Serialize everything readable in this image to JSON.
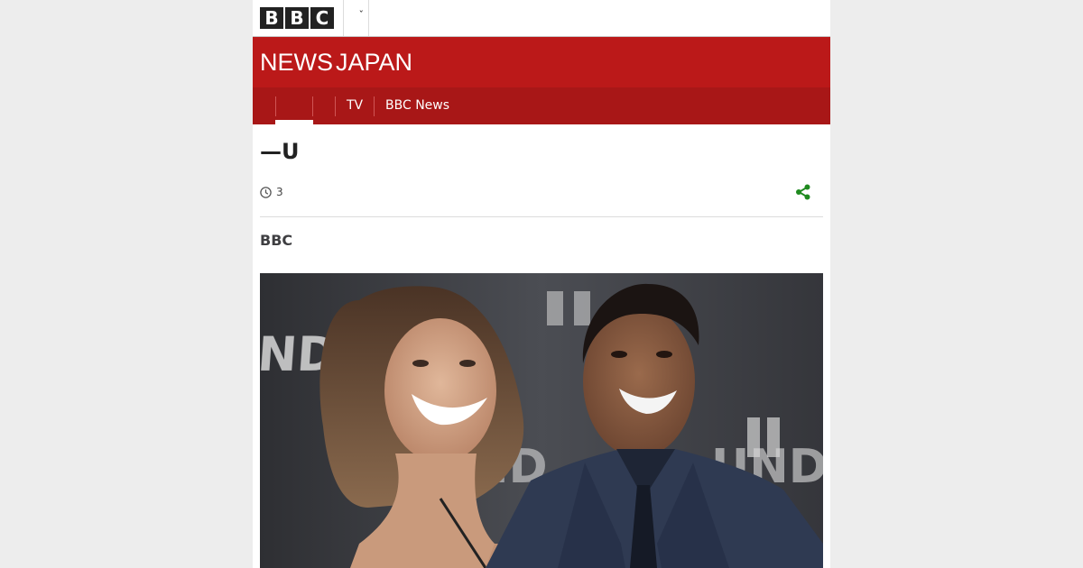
{
  "header": {
    "logo_letters": [
      "B",
      "B",
      "C"
    ],
    "menu_icon": "chevron-down-icon"
  },
  "masthead": {
    "brand_news": "NEWS",
    "brand_japan": "JAPAN",
    "background_color": "#bb1919"
  },
  "nav": {
    "items": [
      {
        "label": "",
        "active": true
      },
      {
        "label": ""
      },
      {
        "label": "TV"
      },
      {
        "label": "BBC News"
      }
    ],
    "background_color": "#a81717"
  },
  "article": {
    "title": "—U",
    "timestamp": "3",
    "clock_icon": "clock-icon",
    "share_icon": "share-icon",
    "share_color": "#1f8a1f",
    "byline": "BBC"
  },
  "photo": {
    "description_icon": "photo"
  }
}
